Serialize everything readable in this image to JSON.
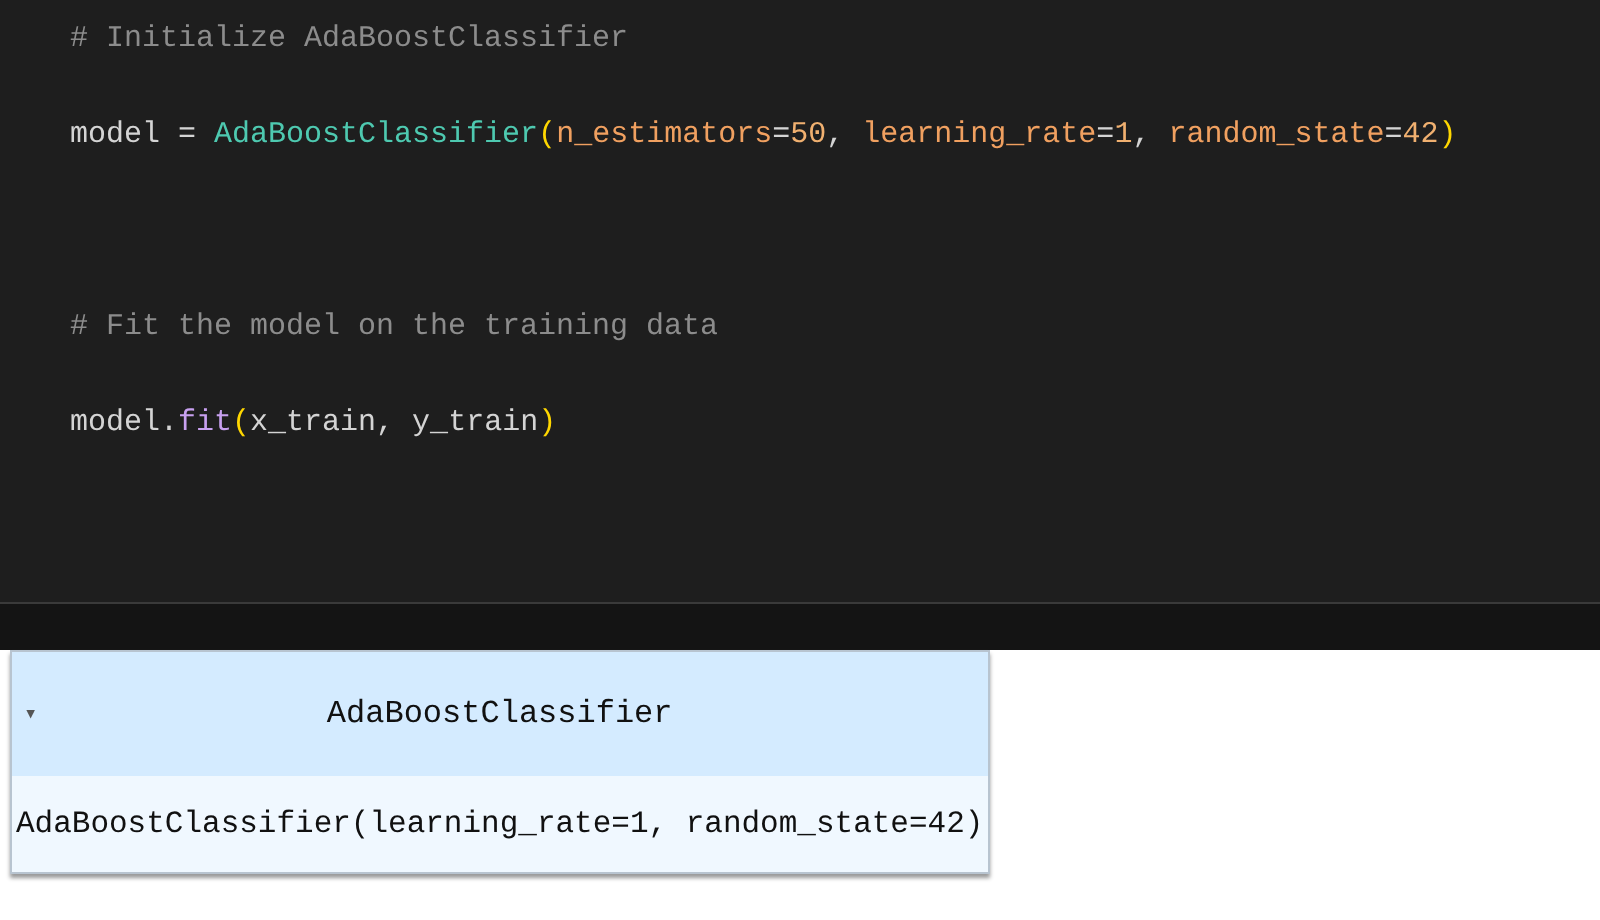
{
  "code": {
    "lines": [
      {
        "kind": "code",
        "tokens": [
          {
            "text": "# Initialize AdaBoostClassifier",
            "kind": "comment"
          }
        ]
      },
      {
        "kind": "code",
        "tokens": [
          {
            "text": "model = ",
            "kind": "plain"
          },
          {
            "text": "AdaBoostClassifier",
            "kind": "class"
          },
          {
            "text": "(",
            "kind": "paren"
          },
          {
            "text": "n_estimators",
            "kind": "param"
          },
          {
            "text": "=",
            "kind": "plain"
          },
          {
            "text": "50",
            "kind": "number"
          },
          {
            "text": ", ",
            "kind": "plain"
          },
          {
            "text": "learning_rate",
            "kind": "param"
          },
          {
            "text": "=",
            "kind": "plain"
          },
          {
            "text": "1",
            "kind": "number"
          },
          {
            "text": ", ",
            "kind": "plain"
          },
          {
            "text": "random_state",
            "kind": "param"
          },
          {
            "text": "=",
            "kind": "plain"
          },
          {
            "text": "42",
            "kind": "number"
          },
          {
            "text": ")",
            "kind": "paren"
          }
        ]
      },
      {
        "kind": "blank"
      },
      {
        "kind": "code",
        "tokens": [
          {
            "text": "# Fit the model on the training data",
            "kind": "comment"
          }
        ]
      },
      {
        "kind": "code",
        "tokens": [
          {
            "text": "model.",
            "kind": "plain"
          },
          {
            "text": "fit",
            "kind": "function"
          },
          {
            "text": "(",
            "kind": "paren"
          },
          {
            "text": "x_train, y_train",
            "kind": "plain"
          },
          {
            "text": ")",
            "kind": "paren"
          }
        ]
      }
    ]
  },
  "output": {
    "estimator": {
      "toggle": "▾",
      "expanded": true,
      "title": "AdaBoostClassifier",
      "repr": "AdaBoostClassifier(learning_rate=1, random_state=42)"
    }
  }
}
